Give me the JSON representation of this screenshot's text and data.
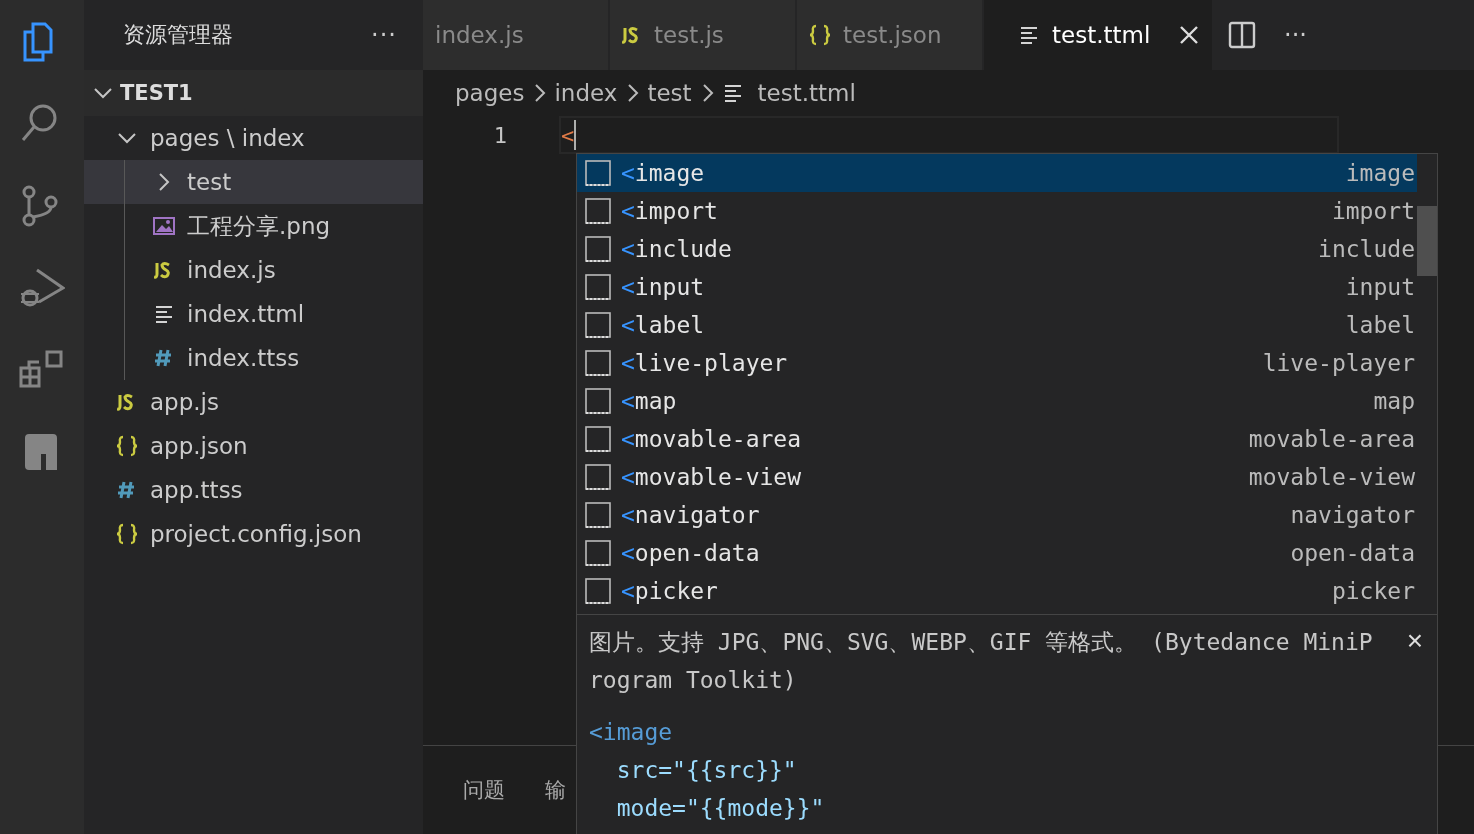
{
  "activity_bar": [
    {
      "kind": "files",
      "selected": true
    },
    {
      "kind": "search",
      "selected": false
    },
    {
      "kind": "source-control",
      "selected": false
    },
    {
      "kind": "run",
      "selected": false
    },
    {
      "kind": "extensions",
      "selected": false
    },
    {
      "kind": "app",
      "selected": false
    }
  ],
  "sidebar": {
    "title": "资源管理器",
    "more": "···",
    "root": {
      "label": "TEST1",
      "expanded": true
    },
    "tree": [
      {
        "label": "pages \\ index",
        "kind": "folder",
        "expanded": true,
        "selected": false,
        "children": [
          {
            "label": "test",
            "kind": "folder",
            "expanded": false,
            "selected": true
          },
          {
            "label": "工程分享.png",
            "kind": "image",
            "selected": false
          },
          {
            "label": "index.js",
            "kind": "js",
            "selected": false
          },
          {
            "label": "index.ttml",
            "kind": "ttml",
            "selected": false
          },
          {
            "label": "index.ttss",
            "kind": "css",
            "selected": false
          }
        ]
      },
      {
        "label": "app.js",
        "kind": "js",
        "selected": false
      },
      {
        "label": "app.json",
        "kind": "json",
        "selected": false
      },
      {
        "label": "app.ttss",
        "kind": "css",
        "selected": false
      },
      {
        "label": "project.config.json",
        "kind": "json",
        "selected": false
      }
    ]
  },
  "tabs": [
    {
      "label": "index.js",
      "kind": "none",
      "selected": false
    },
    {
      "label": "test.js",
      "kind": "js",
      "selected": false
    },
    {
      "label": "test.json",
      "kind": "json",
      "selected": false
    },
    {
      "label": "test.ttml",
      "kind": "ttml",
      "selected": true
    }
  ],
  "tab_actions": {
    "more": "···"
  },
  "breadcrumb": [
    {
      "label": "pages",
      "kind": "folder"
    },
    {
      "label": "index",
      "kind": "folder"
    },
    {
      "label": "test",
      "kind": "folder"
    },
    {
      "label": "test.ttml",
      "kind": "ttml"
    }
  ],
  "editor": {
    "line_number": "1",
    "code": "<"
  },
  "suggestions": [
    {
      "label": "<image",
      "detail": "image",
      "selected": true
    },
    {
      "label": "<import",
      "detail": "import",
      "selected": false
    },
    {
      "label": "<include",
      "detail": "include",
      "selected": false
    },
    {
      "label": "<input",
      "detail": "input",
      "selected": false
    },
    {
      "label": "<label",
      "detail": "label",
      "selected": false
    },
    {
      "label": "<live-player",
      "detail": "live-player",
      "selected": false
    },
    {
      "label": "<map",
      "detail": "map",
      "selected": false
    },
    {
      "label": "<movable-area",
      "detail": "movable-area",
      "selected": false
    },
    {
      "label": "<movable-view",
      "detail": "movable-view",
      "selected": false
    },
    {
      "label": "<navigator",
      "detail": "navigator",
      "selected": false
    },
    {
      "label": "<open-data",
      "detail": "open-data",
      "selected": false
    },
    {
      "label": "<picker",
      "detail": "picker",
      "selected": false
    }
  ],
  "details": {
    "doc": "图片。支持 JPG、PNG、SVG、WEBP、GIF 等格式。 (Bytedance MiniProgram Toolkit)",
    "close": "×",
    "snippet": [
      "<image",
      "  src=\"{{src}}\"",
      "  mode=\"{{mode}}\""
    ]
  },
  "panel_tabs": [
    "问题",
    "输"
  ]
}
